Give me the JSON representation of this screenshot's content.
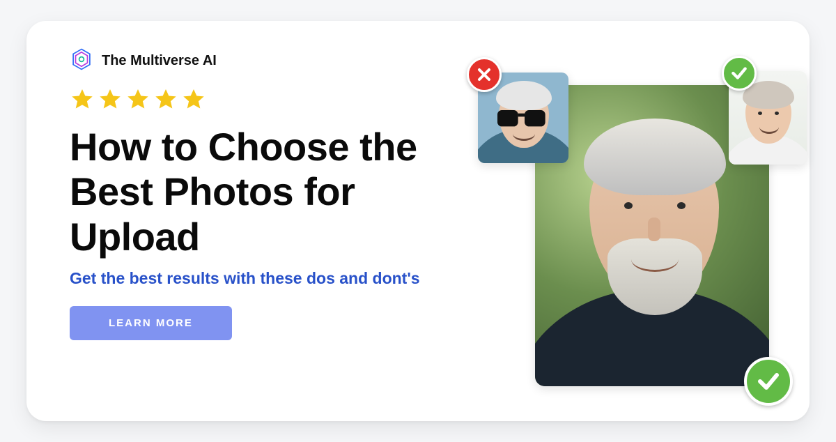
{
  "brand": {
    "name": "The Multiverse AI"
  },
  "rating": {
    "stars": 5
  },
  "headline": "How to Choose the Best Photos for Upload",
  "subhead": "Get the best results with these dos and dont's",
  "cta": {
    "label": "LEARN MORE"
  },
  "colors": {
    "link_blue": "#2851c9",
    "cta_bg": "#8093f1",
    "star": "#f5c518",
    "badge_good": "#62bb46",
    "badge_bad": "#e4312b"
  },
  "photos": {
    "main": {
      "desc": "close-up grey-hair bearded man, green bokeh background",
      "status": "good"
    },
    "left": {
      "desc": "man with sunglasses, blue wall",
      "status": "bad"
    },
    "right": {
      "desc": "man smiling, white tee, light background",
      "status": "good"
    }
  }
}
